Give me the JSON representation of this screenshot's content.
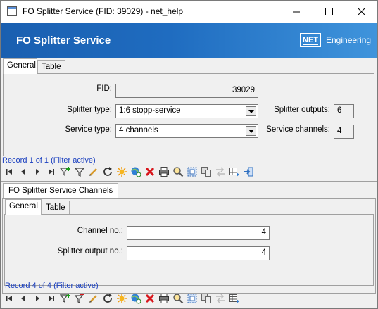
{
  "window": {
    "title": "FO Splitter Service (FID: 39029) - net_help"
  },
  "banner": {
    "title": "FO Splitter Service",
    "logo_mark": "NET",
    "logo_text": "Engineering"
  },
  "main": {
    "tabs": [
      {
        "label": "General",
        "active": true
      },
      {
        "label": "Table",
        "active": false
      }
    ],
    "fid": {
      "label": "FID:",
      "value": "39029"
    },
    "splitter_type": {
      "label": "Splitter type:",
      "value": "1:6 stopp-service"
    },
    "service_type": {
      "label": "Service type:",
      "value": "4 channels"
    },
    "splitter_outputs": {
      "label": "Splitter outputs:",
      "value": "6"
    },
    "service_channels": {
      "label": "Service channels:",
      "value": "4"
    },
    "record_status": "Record 1 of 1 (Filter active)"
  },
  "subform": {
    "title": "FO Splitter Service Channels",
    "tabs": [
      {
        "label": "General",
        "active": true
      },
      {
        "label": "Table",
        "active": false
      }
    ],
    "channel_no": {
      "label": "Channel no.:",
      "value": "4"
    },
    "splitter_output_no": {
      "label": "Splitter output no.:",
      "value": "4"
    },
    "record_status": "Record 4 of 4 (Filter active)"
  },
  "toolbar_icons": [
    "first-record-icon",
    "previous-record-icon",
    "next-record-icon",
    "last-record-icon",
    "filter-add-icon",
    "filter-icon",
    "edit-icon",
    "refresh-icon",
    "new-record-icon",
    "globe-sync-icon",
    "delete-icon",
    "print-icon",
    "zoom-icon",
    "select-area-icon",
    "copy-icon",
    "arrows-icon",
    "table-export-icon",
    "exit-icon"
  ],
  "colors": {
    "banner_start": "#1a5fb0",
    "banner_end": "#3f94dc",
    "record_status": "#1a3fbf",
    "delete_red": "#d8161c"
  }
}
